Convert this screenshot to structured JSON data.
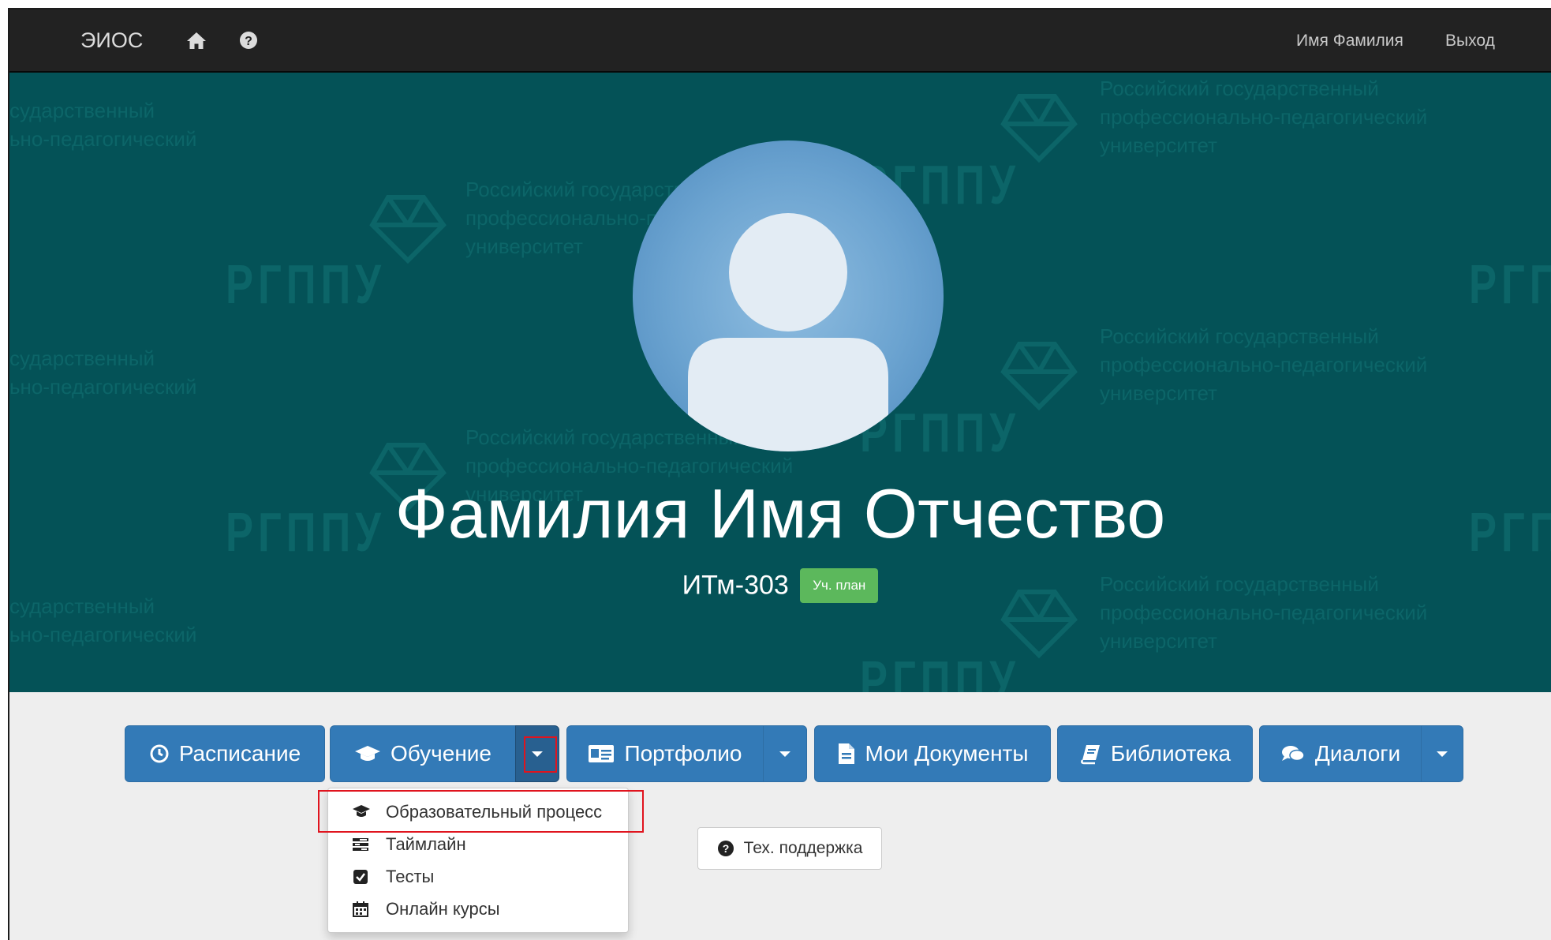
{
  "navbar": {
    "brand": "ЭИОС",
    "home_icon": "home-icon",
    "help_icon": "question-circle-icon",
    "user_name": "Имя Фамилия",
    "logout": "Выход"
  },
  "hero": {
    "watermark_text_line1": "Российский государственный",
    "watermark_text_line2": "профессионально-педагогический",
    "watermark_text_line3": "университет",
    "watermark_left_line1": "сударственный",
    "watermark_left_line2": "ьно-педагогический",
    "watermark_abbr": "РГППУ",
    "avatar_icon": "user-avatar-icon",
    "full_name": "Фамилия Имя Отчество",
    "group": "ИТм-303",
    "plan_badge": "Уч. план",
    "colors": {
      "background": "#045257",
      "badge": "#5cb85c"
    }
  },
  "toolbar": {
    "schedule": {
      "label": "Расписание",
      "icon": "clock-icon"
    },
    "education": {
      "label": "Обучение",
      "icon": "graduation-cap-icon"
    },
    "portfolio": {
      "label": "Портфолио",
      "icon": "id-card-icon"
    },
    "documents": {
      "label": "Мои Документы",
      "icon": "file-icon"
    },
    "library": {
      "label": "Библиотека",
      "icon": "book-icon"
    },
    "dialogs": {
      "label": "Диалоги",
      "icon": "comments-icon"
    },
    "colors": {
      "button": "#337ab7"
    }
  },
  "education_menu": {
    "items": [
      {
        "label": "Образовательный процесс",
        "icon": "graduation-cap-icon"
      },
      {
        "label": "Таймлайн",
        "icon": "tasks-icon"
      },
      {
        "label": "Тесты",
        "icon": "check-square-icon"
      },
      {
        "label": "Онлайн курсы",
        "icon": "calendar-icon"
      }
    ]
  },
  "support": {
    "label": "Тех. поддержка",
    "icon": "question-circle-icon"
  },
  "highlight_color": "#e0141e"
}
